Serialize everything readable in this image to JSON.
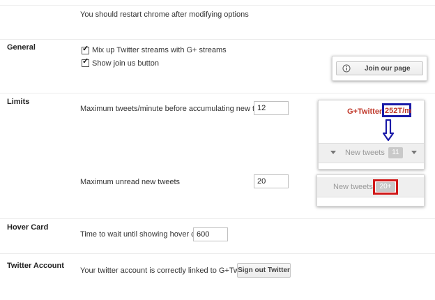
{
  "notice": "You should restart chrome after modifying options",
  "general": {
    "title": "General",
    "options": [
      {
        "label": "Mix up Twitter streams with G+ streams",
        "checked": true
      },
      {
        "label": "Show join us button",
        "checked": true
      }
    ],
    "preview_button": "Join our page"
  },
  "limits": {
    "title": "Limits",
    "max_tweets_label": "Maximum tweets/minute before accumulating new tweets",
    "max_tweets_value": "12",
    "max_unread_label": "Maximum unread new tweets",
    "max_unread_value": "20",
    "preview1": {
      "stream_name": "G+Twitter",
      "separator": "-",
      "rate": "252T/m",
      "new_tweets_label": "New tweets",
      "count": "11"
    },
    "preview2": {
      "new_tweets_label": "New tweets",
      "count": "20+"
    }
  },
  "hover_card": {
    "title": "Hover Card",
    "label": "Time to wait until showing hover card",
    "value": "600"
  },
  "twitter_account": {
    "title": "Twitter Account",
    "status": "Your twitter account is correctly linked to G+Twitter",
    "sign_out_label": "Sign out Twitter"
  },
  "colors": {
    "highlight_blue": "#1a1aa8",
    "highlight_red": "#d01818",
    "stream_name_red": "#c0392b"
  }
}
